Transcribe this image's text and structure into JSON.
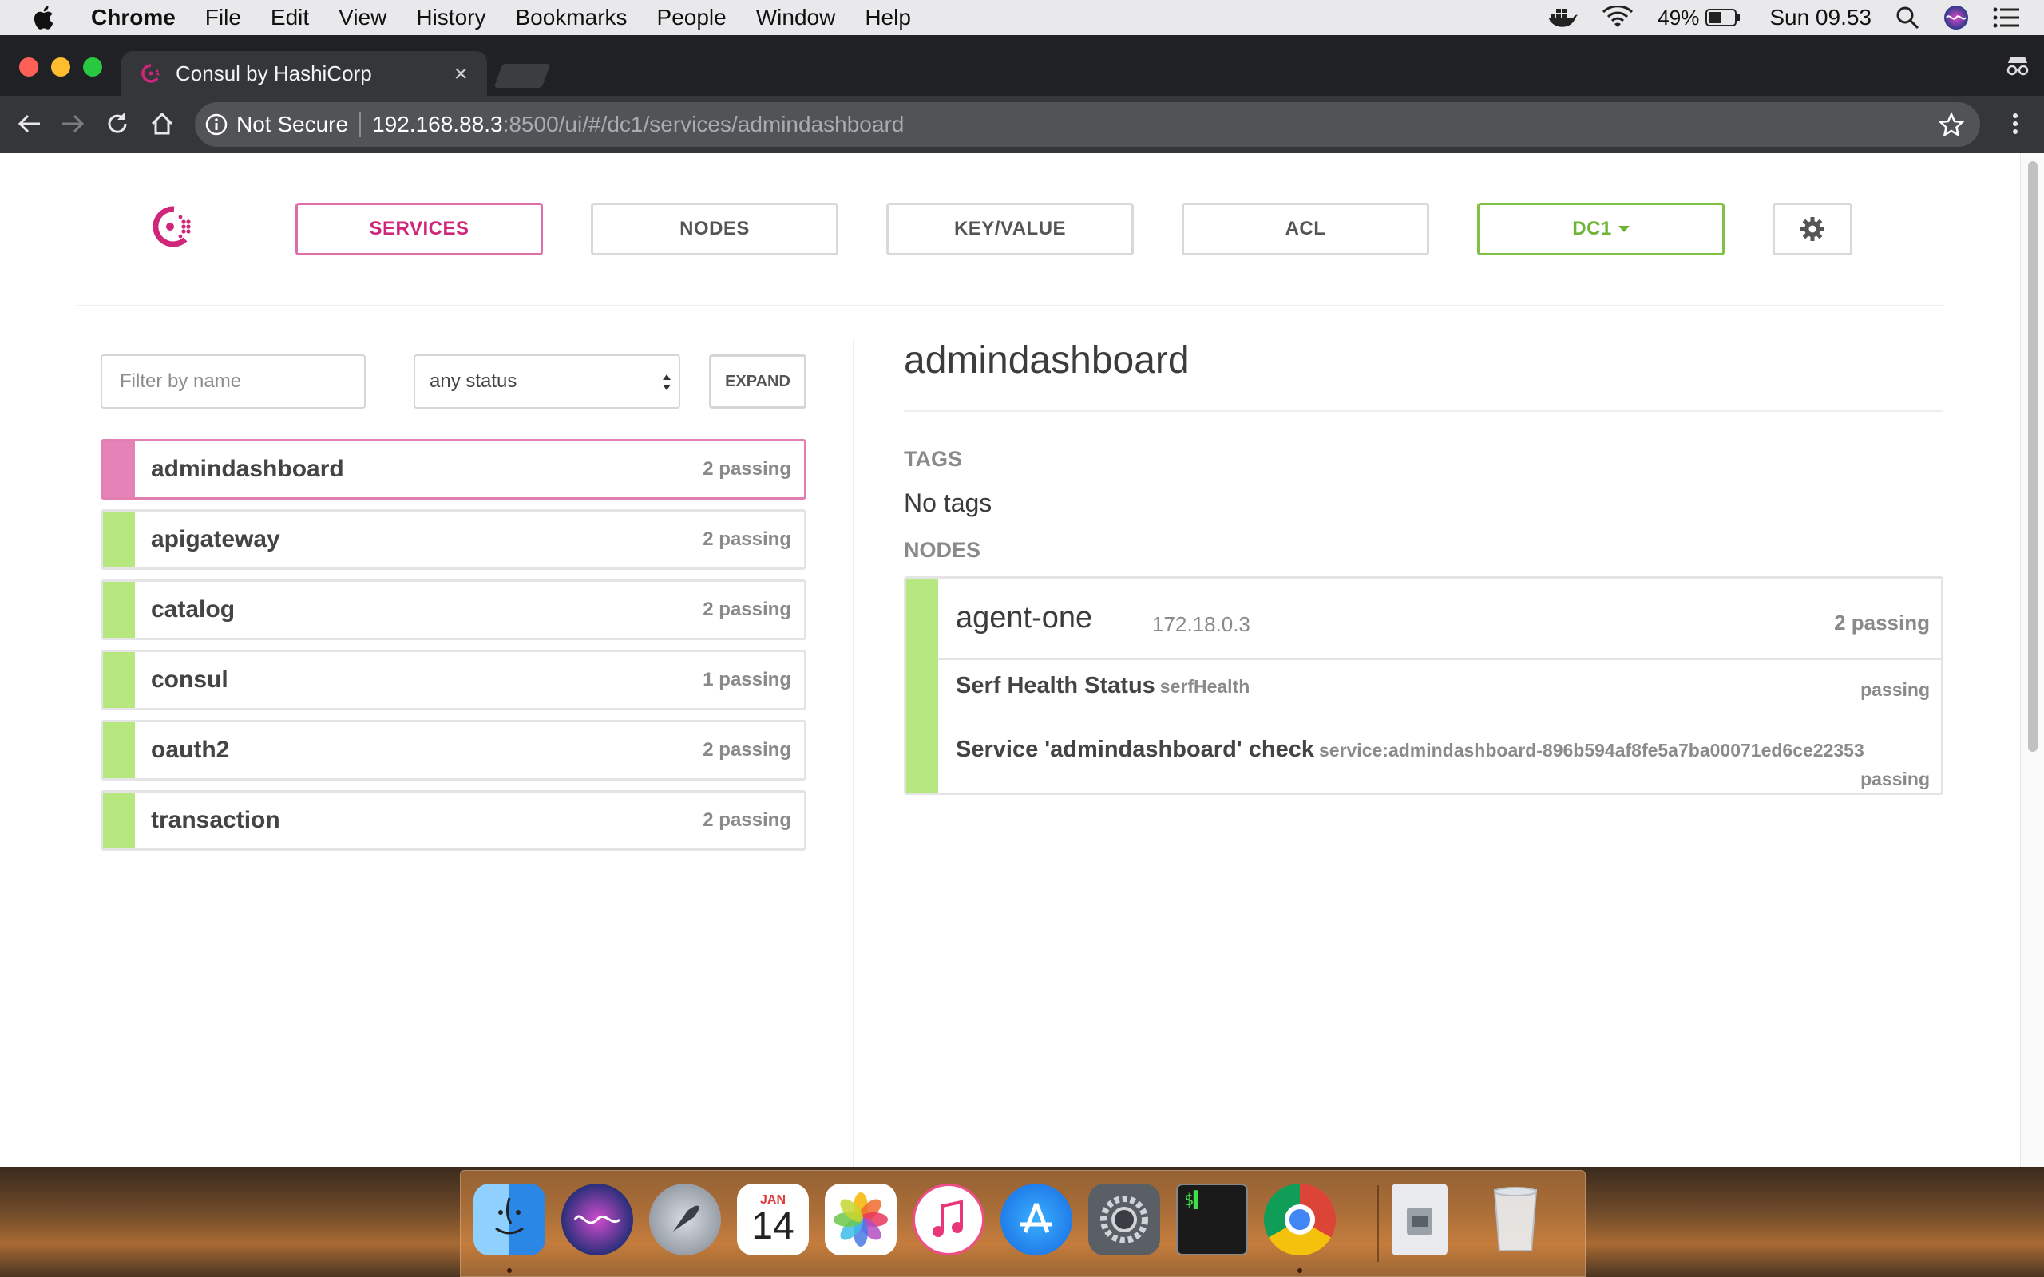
{
  "menubar": {
    "app": "Chrome",
    "items": [
      "File",
      "Edit",
      "View",
      "History",
      "Bookmarks",
      "People",
      "Window",
      "Help"
    ],
    "battery": "49%",
    "clock": "Sun 09.53"
  },
  "browser": {
    "tab_title": "Consul by HashiCorp",
    "security_label": "Not Secure",
    "url_host": "192.168.88.3",
    "url_path": ":8500/ui/#/dc1/services/admindashboard"
  },
  "nav": {
    "services": "SERVICES",
    "nodes": "NODES",
    "keyvalue": "KEY/VALUE",
    "acl": "ACL",
    "datacenter": "DC1"
  },
  "filters": {
    "name_placeholder": "Filter by name",
    "status_value": "any status",
    "expand_label": "EXPAND"
  },
  "services": [
    {
      "name": "admindashboard",
      "checks": "2 passing",
      "selected": true
    },
    {
      "name": "apigateway",
      "checks": "2 passing"
    },
    {
      "name": "catalog",
      "checks": "2 passing"
    },
    {
      "name": "consul",
      "checks": "1 passing"
    },
    {
      "name": "oauth2",
      "checks": "2 passing"
    },
    {
      "name": "transaction",
      "checks": "2 passing"
    }
  ],
  "detail": {
    "title": "admindashboard",
    "tags_label": "TAGS",
    "tags_value": "No tags",
    "nodes_label": "NODES",
    "node": {
      "name": "agent-one",
      "ip": "172.18.0.3",
      "checks": "2 passing",
      "health_checks": [
        {
          "name": "Serf Health Status",
          "id": "serfHealth",
          "status": "passing"
        },
        {
          "name": "Service 'admindashboard' check",
          "id": "service:admindashboard-896b594af8fe5a7ba00071ed6ce22353",
          "status": "passing"
        }
      ]
    }
  },
  "dock": {
    "calendar_month": "JAN",
    "calendar_day": "14"
  },
  "colors": {
    "brand_pink": "#d0267a",
    "passing_green": "#b7e87f",
    "dc_green": "#6eb536"
  }
}
